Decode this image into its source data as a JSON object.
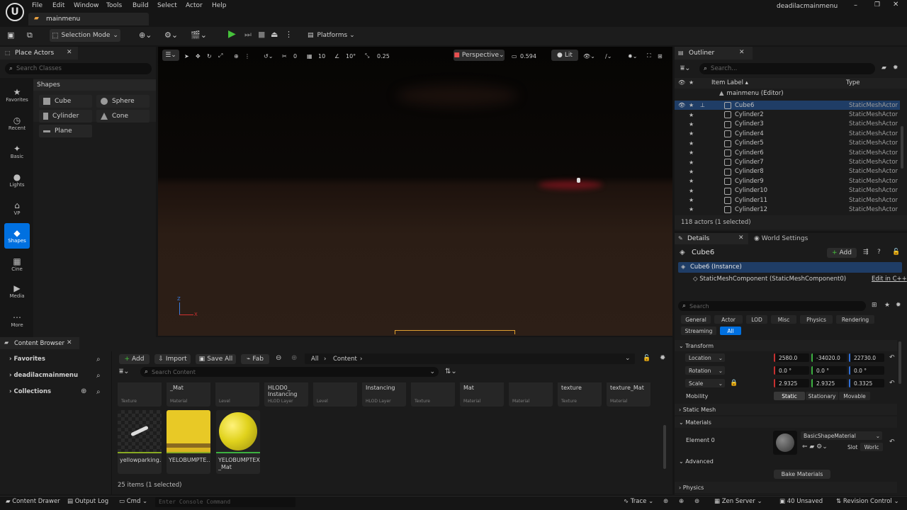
{
  "app": {
    "logo": "U",
    "project_name": "deadilacmainmenu",
    "level_tab": "mainmenu"
  },
  "menu": [
    "File",
    "Edit",
    "Window",
    "Tools",
    "Build",
    "Select",
    "Actor",
    "Help"
  ],
  "toolbar": {
    "mode_label": "Selection Mode",
    "platforms_label": "Platforms"
  },
  "place_actors": {
    "tab_label": "Place Actors",
    "search_placeholder": "Search Classes",
    "sidebar": [
      "Favorites",
      "Recent",
      "Basic",
      "Lights",
      "VP",
      "Shapes",
      "Cine",
      "Media",
      "More"
    ],
    "active_category": "Shapes",
    "section_title": "Shapes",
    "shapes": [
      "Cube",
      "Sphere",
      "Cylinder",
      "Cone",
      "Plane"
    ]
  },
  "viewport": {
    "perspective_label": "Perspective",
    "lit_label": "Lit",
    "grid_snap": "10",
    "rotation_snap": "10°",
    "scale_snap": "0.25",
    "camera_speed": "0.594",
    "zero_label": "0",
    "axis_z": "Z",
    "axis_x": "X"
  },
  "outliner": {
    "tab_label": "Outliner",
    "search_placeholder": "Search...",
    "col_label": "Item Label ▴",
    "col_type": "Type",
    "root": "mainmenu (Editor)",
    "rows": [
      {
        "label": "Cube6",
        "type": "StaticMeshActor",
        "selected": true
      },
      {
        "label": "Cylinder2",
        "type": "StaticMeshActor"
      },
      {
        "label": "Cylinder3",
        "type": "StaticMeshActor"
      },
      {
        "label": "Cylinder4",
        "type": "StaticMeshActor"
      },
      {
        "label": "Cylinder5",
        "type": "StaticMeshActor"
      },
      {
        "label": "Cylinder6",
        "type": "StaticMeshActor"
      },
      {
        "label": "Cylinder7",
        "type": "StaticMeshActor"
      },
      {
        "label": "Cylinder8",
        "type": "StaticMeshActor"
      },
      {
        "label": "Cylinder9",
        "type": "StaticMeshActor"
      },
      {
        "label": "Cylinder10",
        "type": "StaticMeshActor"
      },
      {
        "label": "Cylinder11",
        "type": "StaticMeshActor"
      },
      {
        "label": "Cylinder12",
        "type": "StaticMeshActor"
      }
    ],
    "footer": "118 actors (1 selected)"
  },
  "details": {
    "tab_label": "Details",
    "world_settings_label": "World Settings",
    "object_name": "Cube6",
    "add_label": "Add",
    "instance_label": "Cube6 (Instance)",
    "component_label": "StaticMeshComponent (StaticMeshComponent0)",
    "edit_cpp_label": "Edit in C++",
    "search_placeholder": "Search",
    "filters": [
      "General",
      "Actor",
      "LOD",
      "Misc",
      "Physics",
      "Rendering",
      "Streaming",
      "All"
    ],
    "transform_title": "Transform",
    "location_label": "Location",
    "location": [
      "2580.0",
      "-34020.0",
      "22730.0"
    ],
    "rotation_label": "Rotation",
    "rotation": [
      "0.0 °",
      "0.0 °",
      "0.0 °"
    ],
    "scale_label": "Scale",
    "scale": [
      "2.9325",
      "2.9325",
      "0.3325"
    ],
    "mobility_label": "Mobility",
    "mobility_options": [
      "Static",
      "Stationary",
      "Movable"
    ],
    "static_mesh_title": "Static Mesh",
    "materials_title": "Materials",
    "element_label": "Element 0",
    "material_name": "BasicShapeMaterial",
    "slot_label": "Slot",
    "slot_value": "Worlc",
    "advanced_label": "Advanced",
    "bake_label": "Bake Materials",
    "physics_title": "Physics"
  },
  "content_browser": {
    "tab_label": "Content Browser",
    "tree": [
      "Favorites",
      "deadilacmainmenu",
      "Collections"
    ],
    "add_label": "Add",
    "import_label": "Import",
    "save_all_label": "Save All",
    "fab_label": "Fab",
    "path_all": "All",
    "path_content": "Content",
    "search_placeholder": "Search Content",
    "top_tiles": [
      {
        "name": "",
        "type": "Texture"
      },
      {
        "name": "_Mat",
        "type": "Material"
      },
      {
        "name": "",
        "type": "Level"
      },
      {
        "name": "HLOD0_ Instancing",
        "type": "HLOD Layer"
      },
      {
        "name": "",
        "type": "Level"
      },
      {
        "name": "Instancing",
        "type": "HLOD Layer"
      },
      {
        "name": "",
        "type": "Texture"
      },
      {
        "name": "Mat",
        "type": "Material"
      },
      {
        "name": "",
        "type": "Material"
      },
      {
        "name": "texture",
        "type": "Texture"
      },
      {
        "name": "texture_Mat",
        "type": "Material"
      }
    ],
    "assets": [
      {
        "name": "yellowparking..."
      },
      {
        "name": "YELOBUMPTE..."
      },
      {
        "name": "YELOBUMPTEX _Mat"
      }
    ],
    "footer": "25 items (1 selected)"
  },
  "statusbar": {
    "content_drawer": "Content Drawer",
    "output_log": "Output Log",
    "cmd": "Cmd",
    "console_placeholder": "Enter Console Command",
    "trace": "Trace",
    "zen_server": "Zen Server",
    "unsaved": "40 Unsaved",
    "revision_control": "Revision Control"
  },
  "colors": {
    "accent": "#0070e0",
    "selected_row": "#1f3d66",
    "sky": "#070605",
    "ground": "#2a1c14",
    "highlight_red": "#e0203a",
    "play_green": "#46c23b"
  }
}
